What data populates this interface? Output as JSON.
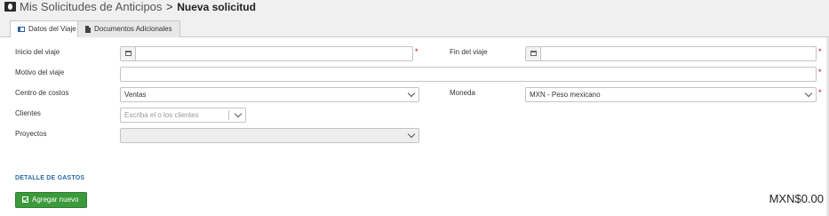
{
  "header": {
    "section": "Mis Solicitudes de Anticipos",
    "separator": ">",
    "current": "Nueva solicitud",
    "icon": "money-icon"
  },
  "tabs": [
    {
      "label": "Datos del Viaje",
      "icon": "list-icon",
      "active": true
    },
    {
      "label": "Documentos Adicionales",
      "icon": "document-icon",
      "active": false
    }
  ],
  "form": {
    "inicio_label": "Inicio del viaje",
    "inicio_value": "",
    "fin_label": "Fin del viaje",
    "fin_value": "",
    "motivo_label": "Motivo del viaje",
    "motivo_value": "",
    "centro_label": "Centro de costos",
    "centro_value": "Ventas",
    "moneda_label": "Moneda",
    "moneda_value": "MXN - Peso mexicano",
    "clientes_label": "Clientes",
    "clientes_placeholder": "Escriba el o los clientes",
    "proyectos_label": "Proyectos",
    "proyectos_value": "",
    "required_mark": "*"
  },
  "gastos": {
    "title": "DETALLE DE GASTOS",
    "add_label": "Agregar nuevo",
    "total": "MXN$0.00"
  },
  "colors": {
    "accent_blue": "#2b6aa8",
    "add_green": "#3c9a3c",
    "required_red": "#cc0000"
  }
}
